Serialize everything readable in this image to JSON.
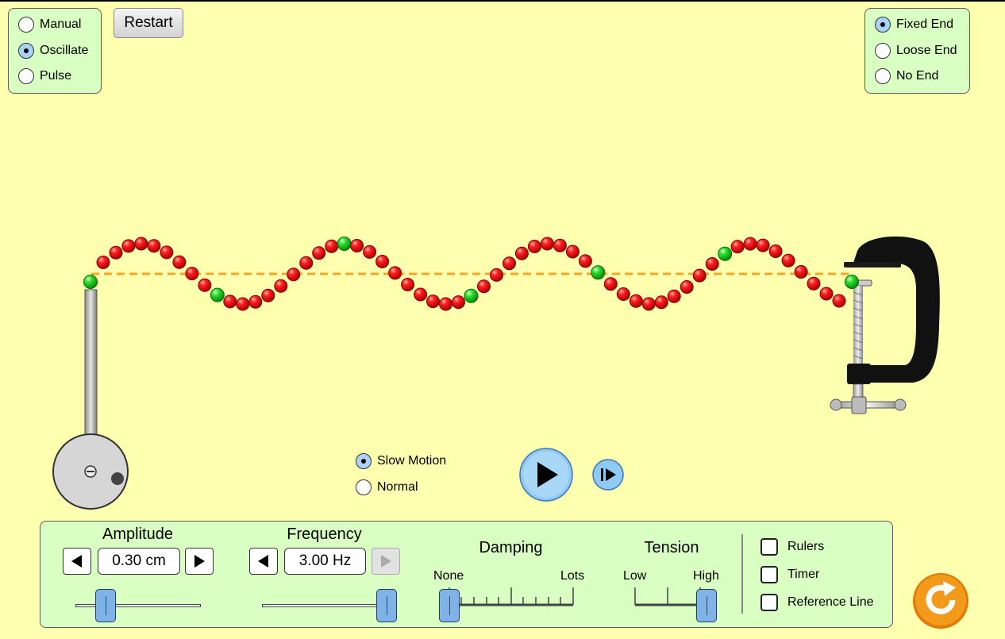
{
  "mode": {
    "options": [
      {
        "label": "Manual",
        "selected": false
      },
      {
        "label": "Oscillate",
        "selected": true
      },
      {
        "label": "Pulse",
        "selected": false
      }
    ]
  },
  "restart_label": "Restart",
  "end": {
    "options": [
      {
        "label": "Fixed End",
        "selected": true
      },
      {
        "label": "Loose End",
        "selected": false
      },
      {
        "label": "No End",
        "selected": false
      }
    ]
  },
  "speed": {
    "options": [
      {
        "label": "Slow Motion",
        "selected": true
      },
      {
        "label": "Normal",
        "selected": false
      }
    ]
  },
  "amplitude": {
    "title": "Amplitude",
    "value": "0.30 cm",
    "level_fraction": 0.25
  },
  "frequency": {
    "title": "Frequency",
    "value": "3.00 Hz",
    "level_fraction": 1.0,
    "increase_disabled": true
  },
  "damping": {
    "title": "Damping",
    "min_label": "None",
    "max_label": "Lots",
    "level_fraction": 0.0
  },
  "tension": {
    "title": "Tension",
    "min_label": "Low",
    "max_label": "High",
    "level_fraction": 1.0
  },
  "options": {
    "checkboxes": [
      {
        "label": "Rulers",
        "checked": false
      },
      {
        "label": "Timer",
        "checked": false
      },
      {
        "label": "Reference Line",
        "checked": false
      }
    ]
  },
  "colors": {
    "background": "#ffffb0",
    "panel": "#d9ffc2",
    "bead_red": "#e00000",
    "bead_green": "#22cc22",
    "reference_line": "#f5a623",
    "accent_blue": "#7fb3e8",
    "reset_orange": "#f49a1a"
  },
  "icons": [
    "play-icon",
    "step-icon",
    "arrow-left-icon",
    "arrow-right-icon",
    "reset-all-icon"
  ]
}
